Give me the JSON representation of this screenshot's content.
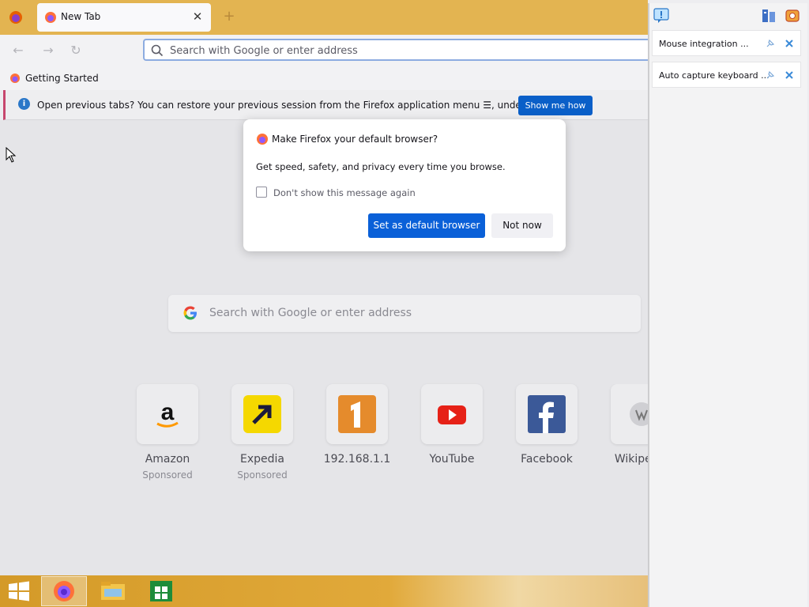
{
  "browser": {
    "tab": {
      "label": "New Tab",
      "close": "✕"
    },
    "new_tab": "+",
    "nav": {
      "back": "←",
      "forward": "→",
      "reload": "↻"
    },
    "urlbar": {
      "placeholder": "Search with Google or enter address"
    },
    "bookmarks": [
      {
        "label": "Getting Started"
      }
    ],
    "notification": {
      "text": "Open previous tabs? You can restore your previous session from the Firefox application menu ☰, under History.",
      "button": "Show me how",
      "info_icon": "i"
    }
  },
  "newtab": {
    "search_placeholder": "Search with Google or enter address",
    "tiles": [
      {
        "label": "Amazon",
        "sub": "Sponsored",
        "icon": "amazon-logo"
      },
      {
        "label": "Expedia",
        "sub": "Sponsored",
        "icon": "expedia-logo"
      },
      {
        "label": "192.168.1.1",
        "sub": "",
        "icon": "site-1-logo"
      },
      {
        "label": "YouTube",
        "sub": "",
        "icon": "youtube-logo"
      },
      {
        "label": "Facebook",
        "sub": "",
        "icon": "facebook-logo"
      },
      {
        "label": "Wikipedia",
        "sub": "",
        "icon": "wikipedia-logo"
      }
    ]
  },
  "dialog": {
    "title": "Make Firefox your default browser?",
    "message": "Get speed, safety, and privacy every time you browse.",
    "checkbox_label": "Don't show this message again",
    "primary": "Set as default browser",
    "secondary": "Not now"
  },
  "side_panel": {
    "items": [
      {
        "label": "Mouse integration ..."
      },
      {
        "label": "Auto capture keyboard ..."
      }
    ]
  },
  "colors": {
    "tabbar": "#e3b451",
    "accent": "#0a60d8",
    "notif_button": "#0a5fc8"
  }
}
